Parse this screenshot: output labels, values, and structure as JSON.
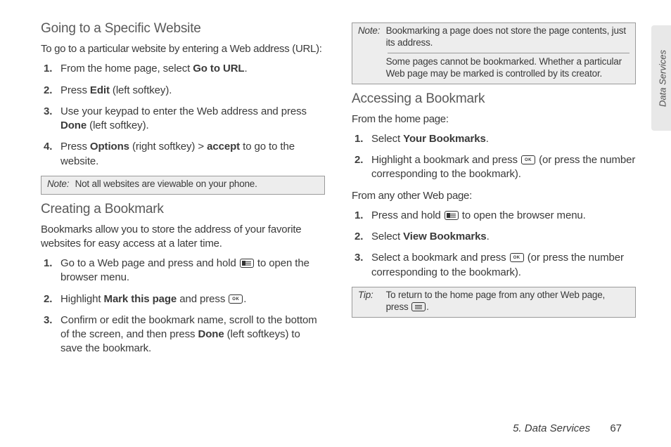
{
  "side_tab": "Data Services",
  "col_left": {
    "h1": "Going to a Specific Website",
    "p1": "To go to a particular website by entering a Web address (URL):",
    "steps1": {
      "s1a": "From the home page, select ",
      "s1b": "Go to URL",
      "s1c": ".",
      "s2a": "Press ",
      "s2b": "Edit",
      "s2c": " (left softkey).",
      "s3a": "Use your keypad to enter the Web address and press ",
      "s3b": "Done",
      "s3c": " (left softkey).",
      "s4a": "Press ",
      "s4b": "Options",
      "s4c": " (right softkey) > ",
      "s4d": "accept",
      "s4e": " to go to the website."
    },
    "note1_label": "Note:",
    "note1": "Not all websites are viewable on your phone.",
    "h2": "Creating a Bookmark",
    "p2": "Bookmarks allow you to store the address of your favorite websites for easy access at a later time.",
    "steps2": {
      "s1a": "Go to a Web page and press and hold ",
      "s1b": " to open the browser menu.",
      "s2a": "Highlight ",
      "s2b": "Mark this page",
      "s2c": " and press ",
      "s2d": ".",
      "s3a": "Confirm or edit the bookmark name, scroll to the bottom of the screen, and then press ",
      "s3b": "Done",
      "s3c": " (left softkeys) to save the bookmark."
    }
  },
  "col_right": {
    "note2_label": "Note:",
    "note2a": "Bookmarking a page does not store the page contents, just its address.",
    "note2b": "Some pages cannot be bookmarked. Whether a particular Web page may be marked is controlled by its creator.",
    "h1": "Accessing a Bookmark",
    "p1": "From the home page:",
    "steps1": {
      "s1a": "Select ",
      "s1b": "Your Bookmarks",
      "s1c": ".",
      "s2a": "Highlight a bookmark and press ",
      "s2b": " (or press the number corresponding to the bookmark)."
    },
    "p2": "From any other Web page:",
    "steps2": {
      "s1a": "Press and hold ",
      "s1b": " to open the browser menu.",
      "s2a": "Select ",
      "s2b": "View Bookmarks",
      "s2c": ".",
      "s3a": "Select a bookmark and press ",
      "s3b": " (or press the number corresponding to the bookmark)."
    },
    "tip_label": "Tip:",
    "tip_a": "To return to the home page from any other Web page, press ",
    "tip_b": "."
  },
  "footer": {
    "chapter": "5. Data Services",
    "page": "67"
  }
}
